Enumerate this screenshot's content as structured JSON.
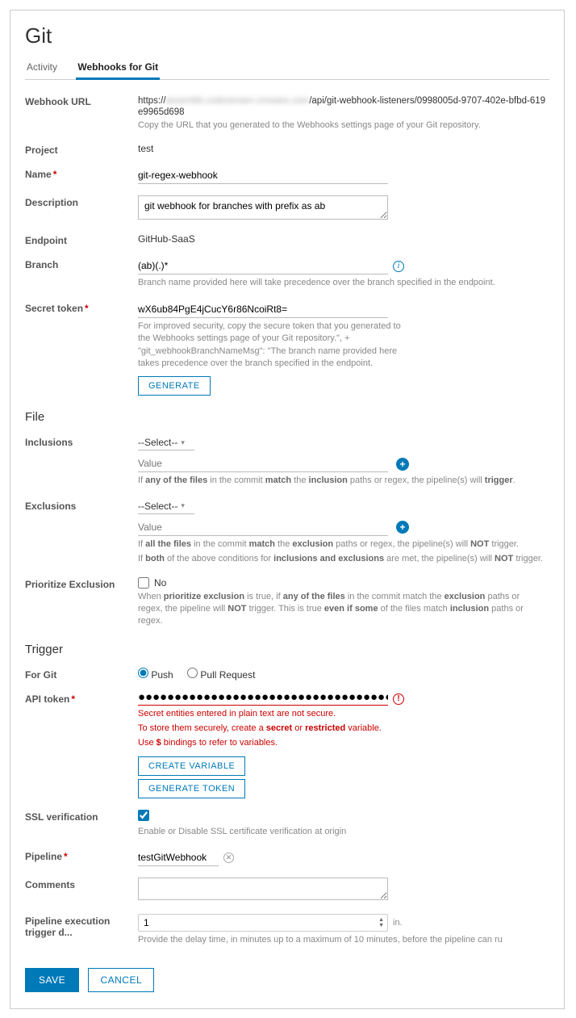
{
  "title": "Git",
  "tabs": {
    "activity": "Activity",
    "webhooks": "Webhooks for Git"
  },
  "labels": {
    "webhook_url": "Webhook URL",
    "project": "Project",
    "name": "Name",
    "description": "Description",
    "endpoint": "Endpoint",
    "branch": "Branch",
    "secret_token": "Secret token",
    "inclusions": "Inclusions",
    "exclusions": "Exclusions",
    "prioritize_exclusion": "Prioritize Exclusion",
    "for_git": "For Git",
    "api_token": "API token",
    "ssl_verification": "SSL verification",
    "pipeline": "Pipeline",
    "comments": "Comments",
    "delay": "Pipeline execution trigger d..."
  },
  "values": {
    "url_prefix": "https://",
    "url_obscured": "assemblr.codestream.vmware.com",
    "url_suffix": "/api/git-webhook-listeners/0998005d-9707-402e-bfbd-619e9965d698",
    "project": "test",
    "name": "git-regex-webhook",
    "description": "git webhook for branches with prefix as ab",
    "endpoint": "GitHub-SaaS",
    "branch": "(ab)(.)*",
    "secret_token": "wX6ub84PgE4jCucY6r86NcoiRt8=",
    "select_placeholder": "--Select--",
    "value_placeholder": "Value",
    "no_label": "No",
    "push_label": "Push",
    "pr_label": "Pull Request",
    "api_token_masked": "●●●●●●●●●●●●●●●●●●●●●●●●●●●●●●●●●●●●●●●●●●●●●●●●●●●●●●●●●●●●●●●●●●●●●●●●●●●●●●●●●●●●●●●●●●●●●●●●●●●●",
    "pipeline": "testGitWebhook",
    "delay": "1",
    "delay_unit": "in."
  },
  "hints": {
    "url": "Copy the URL that you generated to the Webhooks settings page of your Git repository.",
    "branch": "Branch name provided here will take precedence over the branch specified in the endpoint.",
    "secret": "For improved security, copy the secure token that you generated to the Webhooks settings page of your Git repository.\", + \"git_webhookBranchNameMsg\": \"The branch name provided here takes precedence over the branch specified in the endpoint.",
    "inclusions_html": "If <b>any of the files</b> in the commit <b>match</b> the <b>inclusion</b> paths or regex, the pipeline(s) will <b>trigger</b>.",
    "exclusions1_html": "If <b>all the files</b> in the commit <b>match</b> the <b>exclusion</b> paths or regex, the pipeline(s) will <b>NOT</b> trigger.",
    "exclusions2_html": "If <b>both</b> of the above conditions for <b>inclusions and exclusions</b> are met, the pipeline(s) will <b>NOT</b> trigger.",
    "prioritize_html": "When <b>prioritize exclusion</b> is true, if <b>any of the files</b> in the commit match the <b>exclusion</b> paths or regex, the pipeline will <b>NOT</b> trigger. This is true <b>even if some</b> of the files match <b>inclusion</b> paths or regex.",
    "api1": "Secret entities entered in plain text are not secure.",
    "api2_html": "To store them securely, create a <b>secret</b> or <b>restricted</b> variable.",
    "api3_html": "Use <b>$</b> bindings to refer to variables.",
    "ssl": "Enable or Disable SSL certificate verification at origin",
    "delay": "Provide the delay time, in minutes up to a maximum of 10 minutes, before the pipeline can ru"
  },
  "sections": {
    "file": "File",
    "trigger": "Trigger"
  },
  "buttons": {
    "generate": "GENERATE",
    "create_variable": "CREATE VARIABLE",
    "generate_token": "GENERATE TOKEN",
    "save": "SAVE",
    "cancel": "CANCEL"
  }
}
